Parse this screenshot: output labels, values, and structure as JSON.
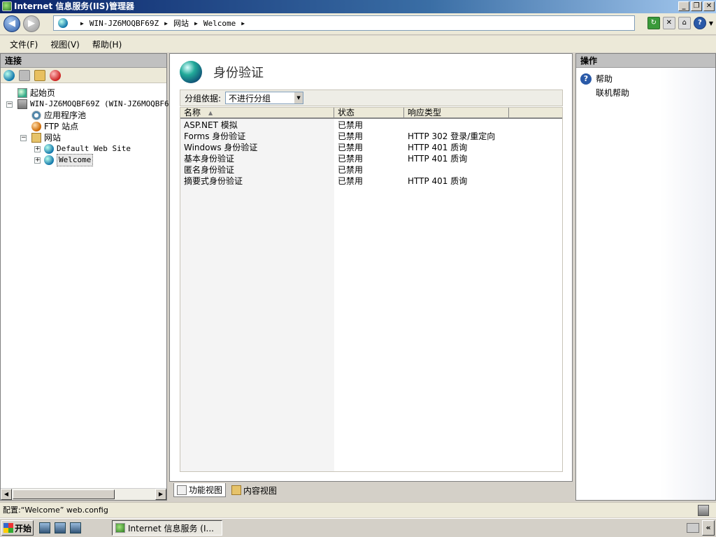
{
  "window": {
    "title": "Internet 信息服务(IIS)管理器"
  },
  "address": {
    "crumbs": [
      "WIN-JZ6MOQBF69Z",
      "网站",
      "Welcome"
    ]
  },
  "menu": [
    "文件(F)",
    "视图(V)",
    "帮助(H)"
  ],
  "connections": {
    "header": "连接",
    "tree": {
      "start_page": "起始页",
      "server": "WIN-JZ6MOQBF69Z (WIN-JZ6MOQBF69Z",
      "app_pools": "应用程序池",
      "ftp_sites": "FTP 站点",
      "sites": "网站",
      "default_site": "Default Web Site",
      "welcome": "Welcome"
    }
  },
  "main": {
    "title": "身份验证",
    "group_by_label": "分组依据:",
    "group_by_value": "不进行分组",
    "columns": [
      "名称",
      "状态",
      "响应类型"
    ],
    "rows": [
      {
        "name": "ASP.NET 模拟",
        "status": "已禁用",
        "response": ""
      },
      {
        "name": "Forms 身份验证",
        "status": "已禁用",
        "response": "HTTP 302 登录/重定向"
      },
      {
        "name": "Windows 身份验证",
        "status": "已禁用",
        "response": "HTTP 401 质询"
      },
      {
        "name": "基本身份验证",
        "status": "已禁用",
        "response": "HTTP 401 质询"
      },
      {
        "name": "匿名身份验证",
        "status": "已禁用",
        "response": ""
      },
      {
        "name": "摘要式身份验证",
        "status": "已禁用",
        "response": "HTTP 401 质询"
      }
    ],
    "tabs": {
      "features": "功能视图",
      "content": "内容视图"
    }
  },
  "actions": {
    "header": "操作",
    "help": "帮助",
    "online_help": "联机帮助"
  },
  "status": {
    "text": "配置:“Welcome” web.config"
  },
  "taskbar": {
    "start": "开始",
    "task": "Internet 信息服务 (I..."
  }
}
